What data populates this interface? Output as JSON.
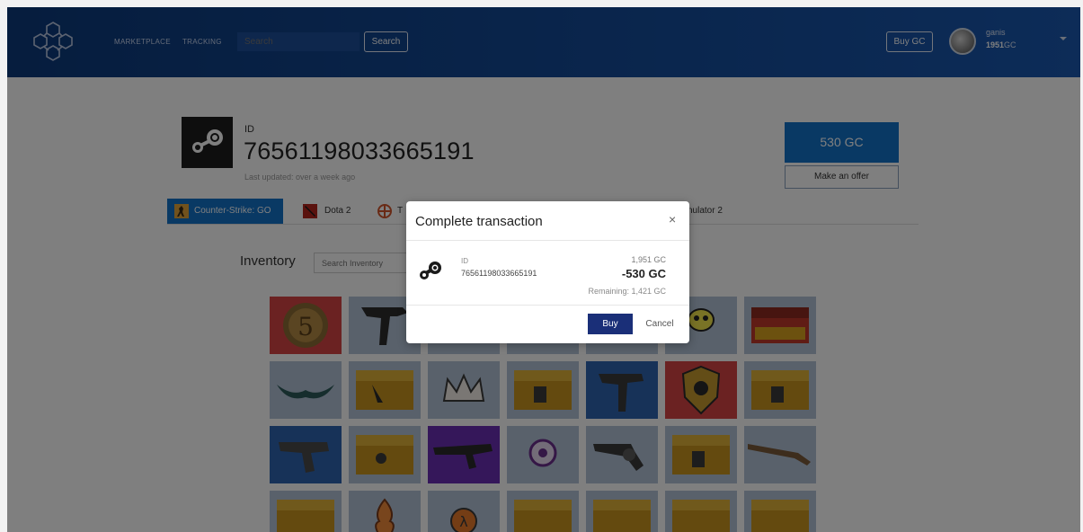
{
  "header": {
    "nav": [
      "MARKETPLACE",
      "TRACKING"
    ],
    "search_placeholder": "Search",
    "search_button": "Search",
    "buy_gc_button": "Buy GC",
    "user": {
      "name": "ganis",
      "gc_amount": "1951",
      "gc_unit": "GC"
    }
  },
  "profile": {
    "id_label": "ID",
    "id_value": "76561198033665191",
    "updated": "Last updated: over a week ago",
    "price_button": "530 GC",
    "offer_button": "Make an offer"
  },
  "tabs": [
    {
      "label": "Counter-Strike: GO",
      "active": true
    },
    {
      "label": "Dota 2",
      "active": false
    },
    {
      "label": "T",
      "active": false
    },
    {
      "label": "nulator 2",
      "active": false
    }
  ],
  "inventory": {
    "title": "Inventory",
    "search_placeholder": "Search Inventory"
  },
  "modal": {
    "title": "Complete transaction",
    "close": "×",
    "id_label": "ID",
    "id_value": "76561198033665191",
    "balance": "1,951 GC",
    "cost": "-530 GC",
    "remaining": "Remaining: 1,421 GC",
    "buy_button": "Buy",
    "cancel_button": "Cancel"
  },
  "colors": {
    "header_start": "#0c3a7c",
    "header_end": "#1a58b0",
    "accent": "#1372c9",
    "buy_button": "#1a2f78"
  }
}
